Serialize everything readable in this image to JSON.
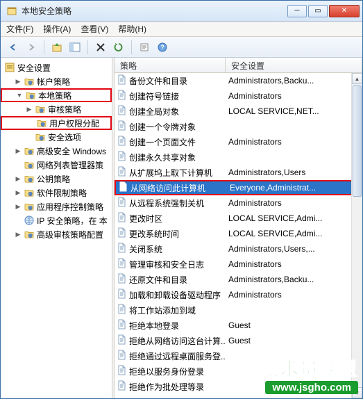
{
  "window": {
    "title": "本地安全策略"
  },
  "menu": {
    "file": "文件(F)",
    "action": "操作(A)",
    "view": "查看(V)",
    "help": "帮助(H)"
  },
  "tree": {
    "root": "安全设置",
    "items": [
      {
        "label": "帐户策略",
        "indent": 1,
        "expander": "▶"
      },
      {
        "label": "本地策略",
        "indent": 1,
        "expander": "▼",
        "redbox": true
      },
      {
        "label": "审核策略",
        "indent": 2,
        "expander": "▶"
      },
      {
        "label": "用户权限分配",
        "indent": 2,
        "expander": "",
        "redbox": true
      },
      {
        "label": "安全选项",
        "indent": 2,
        "expander": ""
      },
      {
        "label": "高级安全 Windows",
        "indent": 1,
        "expander": "▶"
      },
      {
        "label": "网络列表管理器策",
        "indent": 1,
        "expander": ""
      },
      {
        "label": "公钥策略",
        "indent": 1,
        "expander": "▶"
      },
      {
        "label": "软件限制策略",
        "indent": 1,
        "expander": "▶"
      },
      {
        "label": "应用程序控制策略",
        "indent": 1,
        "expander": "▶"
      },
      {
        "label": "IP 安全策略，在 本",
        "indent": 1,
        "expander": "",
        "ip": true
      },
      {
        "label": "高级审核策略配置",
        "indent": 1,
        "expander": "▶"
      }
    ]
  },
  "list": {
    "header": {
      "col1": "策略",
      "col2": "安全设置"
    },
    "rows": [
      {
        "policy": "备份文件和目录",
        "setting": "Administrators,Backu..."
      },
      {
        "policy": "创建符号链接",
        "setting": "Administrators"
      },
      {
        "policy": "创建全局对象",
        "setting": "LOCAL SERVICE,NET..."
      },
      {
        "policy": "创建一个令牌对象",
        "setting": ""
      },
      {
        "policy": "创建一个页面文件",
        "setting": "Administrators"
      },
      {
        "policy": "创建永久共享对象",
        "setting": ""
      },
      {
        "policy": "从扩展坞上取下计算机",
        "setting": "Administrators,Users"
      },
      {
        "policy": "从网络访问此计算机",
        "setting": "Everyone,Administrat...",
        "selected": true,
        "redbox": true
      },
      {
        "policy": "从远程系统强制关机",
        "setting": "Administrators"
      },
      {
        "policy": "更改时区",
        "setting": "LOCAL SERVICE,Admi..."
      },
      {
        "policy": "更改系统时间",
        "setting": "LOCAL SERVICE,Admi..."
      },
      {
        "policy": "关闭系统",
        "setting": "Administrators,Users,..."
      },
      {
        "policy": "管理审核和安全日志",
        "setting": "Administrators"
      },
      {
        "policy": "还原文件和目录",
        "setting": "Administrators,Backu..."
      },
      {
        "policy": "加载和卸载设备驱动程序",
        "setting": "Administrators"
      },
      {
        "policy": "将工作站添加到域",
        "setting": ""
      },
      {
        "policy": "拒绝本地登录",
        "setting": "Guest"
      },
      {
        "policy": "拒绝从网络访问这台计算...",
        "setting": "Guest"
      },
      {
        "policy": "拒绝通过远程桌面服务登...",
        "setting": ""
      },
      {
        "policy": "拒绝以服务身份登录",
        "setting": ""
      },
      {
        "policy": "拒绝作为批处理等录",
        "setting": ""
      }
    ]
  },
  "watermark": {
    "text": "技术员联盟",
    "url": "www.jsgho.com"
  }
}
